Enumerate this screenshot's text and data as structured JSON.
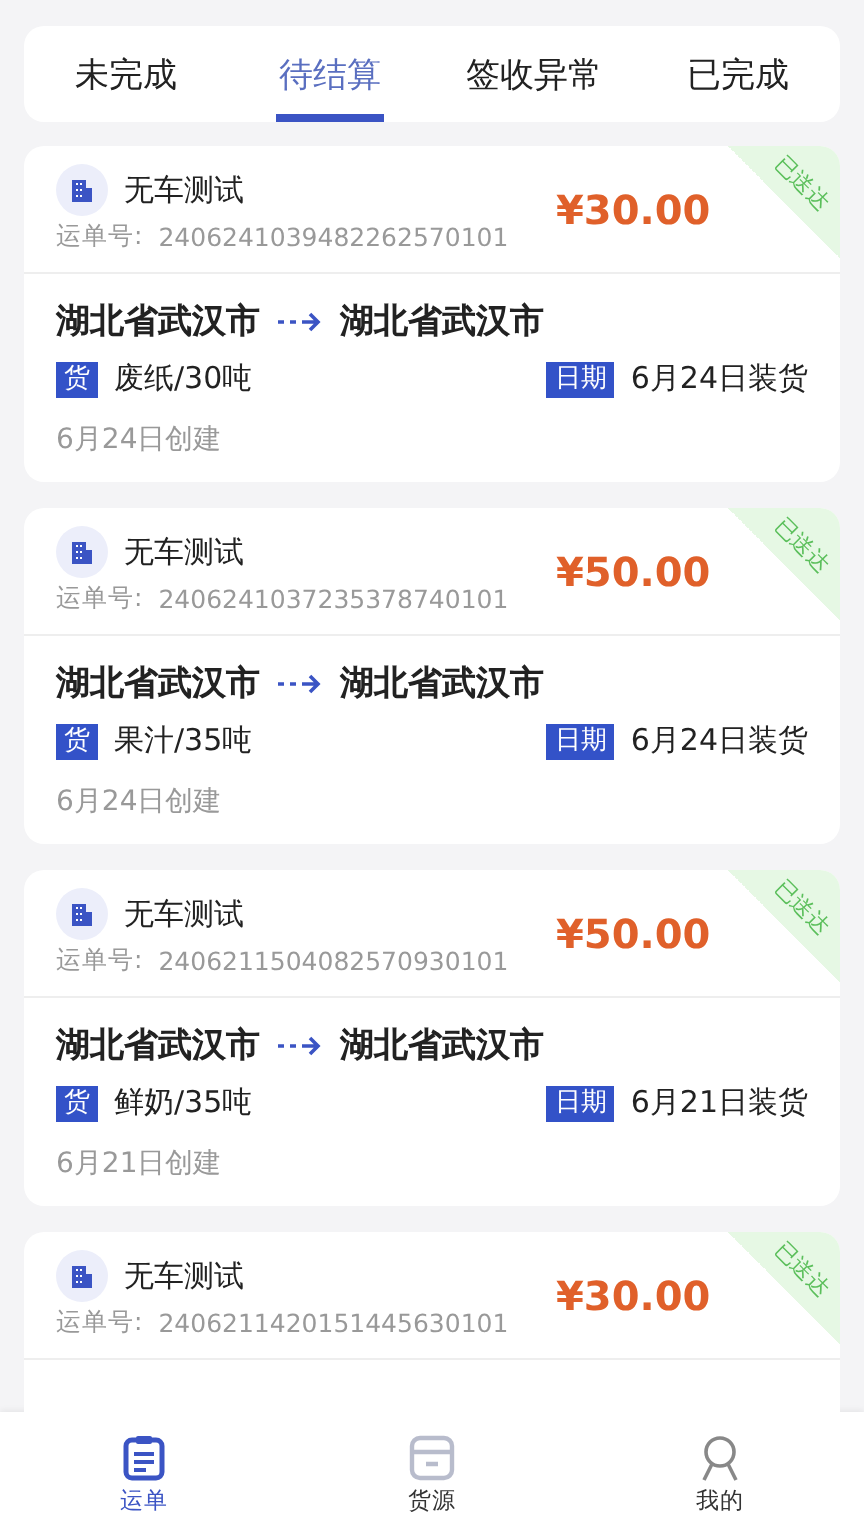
{
  "tabs": [
    {
      "label": "未完成",
      "selected": false
    },
    {
      "label": "待结算",
      "selected": true
    },
    {
      "label": "签收异常",
      "selected": false
    },
    {
      "label": "已完成",
      "selected": false
    }
  ],
  "orders": [
    {
      "company": "无车测试",
      "waybill_label": "运单号:",
      "waybill_no": "2406241039482262570101",
      "price": "¥30.00",
      "status": "已送达",
      "from": "湖北省武汉市",
      "to": "湖北省武汉市",
      "cargo_tag": "货",
      "cargo": "废纸/30吨",
      "date_tag": "日期",
      "load_date": "6月24日装货",
      "created": "6月24日创建"
    },
    {
      "company": "无车测试",
      "waybill_label": "运单号:",
      "waybill_no": "2406241037235378740101",
      "price": "¥50.00",
      "status": "已送达",
      "from": "湖北省武汉市",
      "to": "湖北省武汉市",
      "cargo_tag": "货",
      "cargo": "果汁/35吨",
      "date_tag": "日期",
      "load_date": "6月24日装货",
      "created": "6月24日创建"
    },
    {
      "company": "无车测试",
      "waybill_label": "运单号:",
      "waybill_no": "2406211504082570930101",
      "price": "¥50.00",
      "status": "已送达",
      "from": "湖北省武汉市",
      "to": "湖北省武汉市",
      "cargo_tag": "货",
      "cargo": "鲜奶/35吨",
      "date_tag": "日期",
      "load_date": "6月21日装货",
      "created": "6月21日创建"
    },
    {
      "company": "无车测试",
      "waybill_label": "运单号:",
      "waybill_no": "2406211420151445630101",
      "price": "¥30.00",
      "status": "已送达"
    }
  ],
  "nav": [
    {
      "kind": "waybill",
      "label": "运单",
      "selected": true
    },
    {
      "kind": "cargo",
      "label": "货源",
      "selected": false
    },
    {
      "kind": "me",
      "label": "我的",
      "selected": false
    }
  ]
}
